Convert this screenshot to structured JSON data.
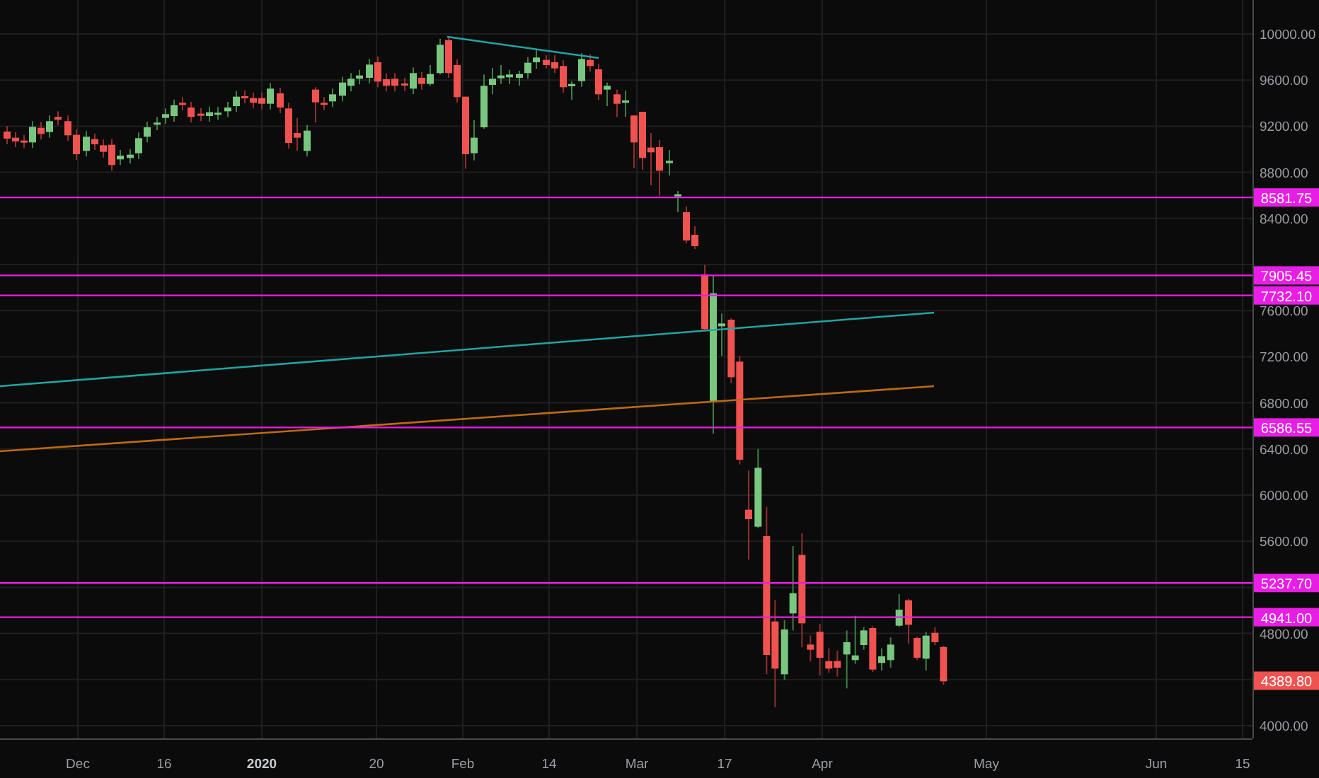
{
  "price_axis": {
    "ticks": [
      "10000.00",
      "9600.00",
      "9200.00",
      "8800.00",
      "8400.00",
      "7600.00",
      "7200.00",
      "6800.00",
      "6400.00",
      "6000.00",
      "5600.00",
      "4800.00",
      "4000.00"
    ]
  },
  "time_axis": {
    "labels": [
      {
        "text": "Dec",
        "kind": "month"
      },
      {
        "text": "16",
        "kind": "day"
      },
      {
        "text": "2020",
        "kind": "year"
      },
      {
        "text": "20",
        "kind": "day"
      },
      {
        "text": "Feb",
        "kind": "month"
      },
      {
        "text": "14",
        "kind": "day"
      },
      {
        "text": "Mar",
        "kind": "month"
      },
      {
        "text": "17",
        "kind": "day"
      },
      {
        "text": "Apr",
        "kind": "month"
      },
      {
        "text": "May",
        "kind": "month"
      },
      {
        "text": "Jun",
        "kind": "month"
      },
      {
        "text": "15",
        "kind": "day"
      }
    ]
  },
  "price_levels": [
    {
      "label": "8581.75",
      "kind": "level"
    },
    {
      "label": "7905.45",
      "kind": "level"
    },
    {
      "label": "7732.10",
      "kind": "level"
    },
    {
      "label": "6586.55",
      "kind": "level"
    },
    {
      "label": "5237.70",
      "kind": "level"
    },
    {
      "label": "4941.00",
      "kind": "level"
    },
    {
      "label": "4389.80",
      "kind": "last_price"
    }
  ]
}
